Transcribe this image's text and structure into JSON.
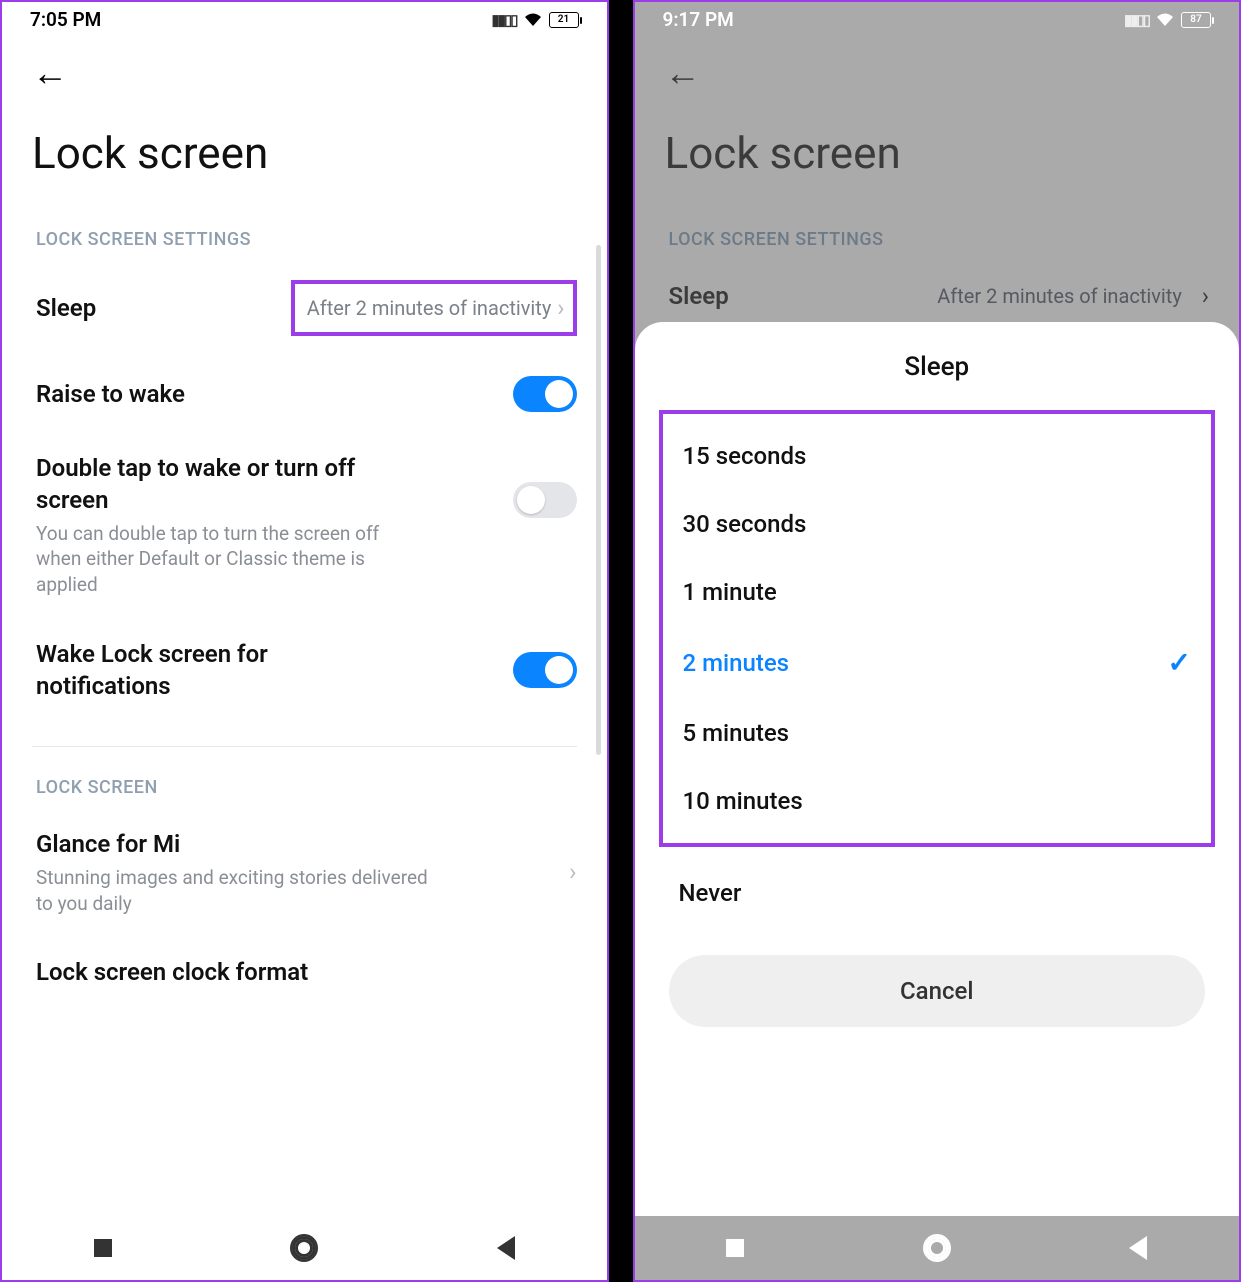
{
  "left": {
    "status": {
      "time": "7:05 PM",
      "battery": "21"
    },
    "title": "Lock screen",
    "section1_label": "LOCK SCREEN SETTINGS",
    "sleep": {
      "label": "Sleep",
      "value": "After 2 minutes of inactivity"
    },
    "raise": {
      "label": "Raise to wake"
    },
    "doubletap": {
      "label": "Double tap to wake or turn off screen",
      "desc": "You can double tap to turn the screen off when either Default or Classic theme is applied"
    },
    "wakelock": {
      "label": "Wake Lock screen for notifications"
    },
    "section2_label": "LOCK SCREEN",
    "glance": {
      "label": "Glance for Mi",
      "desc": "Stunning images and exciting stories delivered to you daily"
    },
    "clockformat": {
      "label": "Lock screen clock format"
    }
  },
  "right": {
    "status": {
      "time": "9:17 PM",
      "battery": "87"
    },
    "title": "Lock screen",
    "section1_label": "LOCK SCREEN SETTINGS",
    "sleep": {
      "label": "Sleep",
      "value": "After 2 minutes of inactivity"
    },
    "sheet": {
      "title": "Sleep",
      "options": {
        "o0": "15 seconds",
        "o1": "30 seconds",
        "o2": "1 minute",
        "o3": "2 minutes",
        "o4": "5 minutes",
        "o5": "10 minutes"
      },
      "never": "Never",
      "cancel": "Cancel"
    }
  }
}
